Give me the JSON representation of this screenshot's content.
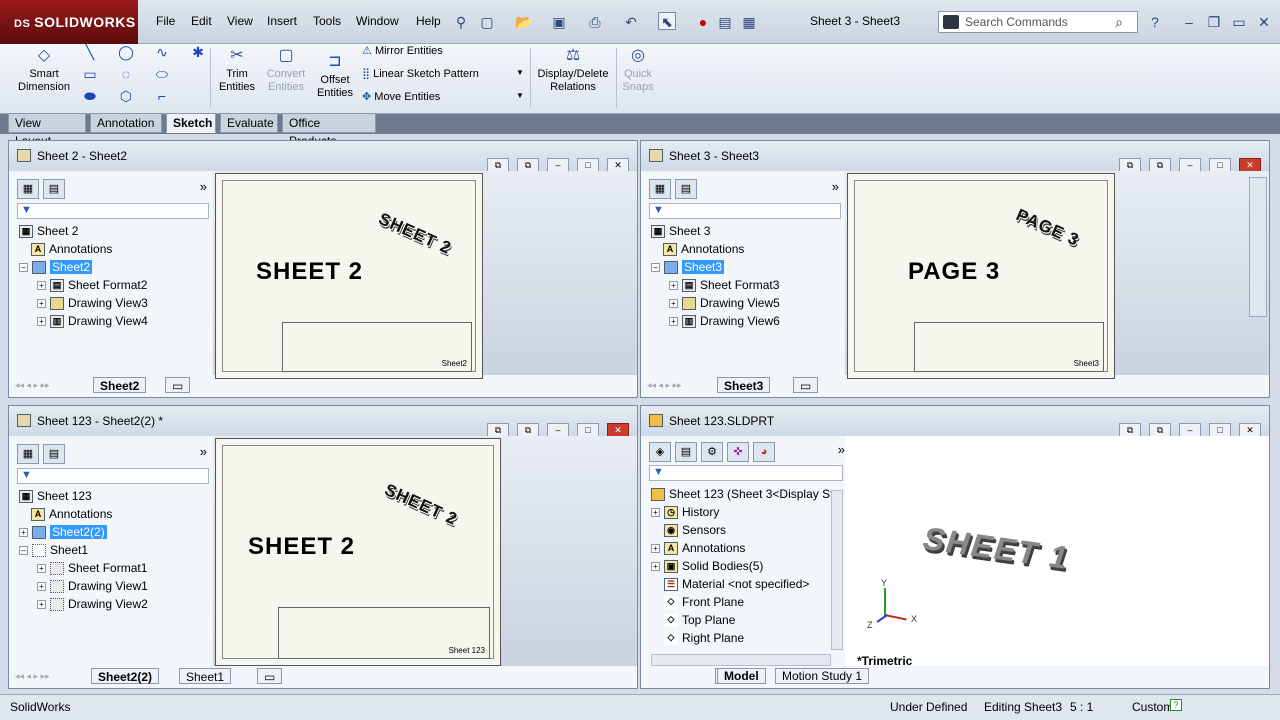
{
  "app": {
    "brand": "SOLIDWORKS",
    "brand_mark": "DS",
    "doc_title": "Sheet 3 - Sheet3"
  },
  "menu": [
    "File",
    "Edit",
    "View",
    "Insert",
    "Tools",
    "Window",
    "Help"
  ],
  "search": {
    "placeholder": "Search Commands"
  },
  "commands": {
    "smart_dimension": "Smart Dimension",
    "trim": "Trim Entities",
    "convert": "Convert Entities",
    "offset": "Offset Entities",
    "mirror": "Mirror Entities",
    "linear_pattern": "Linear Sketch Pattern",
    "move": "Move Entities",
    "display_delete": "Display/Delete Relations",
    "quick_snaps": "Quick Snaps"
  },
  "cm_tabs": [
    "View Layout",
    "Annotation",
    "Sketch",
    "Evaluate",
    "Office Products"
  ],
  "cm_tab_active": 2,
  "pane1": {
    "title": "Sheet 2 - Sheet2",
    "root": "Sheet 2",
    "items": [
      "Annotations",
      "Sheet2",
      "Sheet Format2",
      "Drawing View3",
      "Drawing View4"
    ],
    "sheet_tabs": [
      "Sheet2"
    ],
    "big_text": "SHEET 2",
    "rot_text": "SHEET 2",
    "tb_label": "Sheet2"
  },
  "pane2": {
    "title": "Sheet 3 - Sheet3",
    "root": "Sheet 3",
    "items": [
      "Annotations",
      "Sheet3",
      "Sheet Format3",
      "Drawing View5",
      "Drawing View6"
    ],
    "sheet_tabs": [
      "Sheet3"
    ],
    "big_text": "PAGE 3",
    "rot_text": "PAGE 3",
    "tb_label": "Sheet3"
  },
  "pane3": {
    "title": "Sheet 123 - Sheet2(2) *",
    "root": "Sheet 123",
    "items": [
      "Annotations",
      "Sheet2(2)",
      "Sheet1",
      "Sheet Format1",
      "Drawing View1",
      "Drawing View2"
    ],
    "sheet_tabs": [
      "Sheet2(2)",
      "Sheet1"
    ],
    "big_text": "SHEET 2",
    "rot_text": "SHEET 2",
    "tb_label": "Sheet 123"
  },
  "pane4": {
    "title": "Sheet 123.SLDPRT",
    "root": "Sheet 123  (Sheet 3<Display St",
    "items": [
      "History",
      "Sensors",
      "Annotations",
      "Solid Bodies(5)",
      "Material <not specified>",
      "Front Plane",
      "Top Plane",
      "Right Plane"
    ],
    "model_text": "SHEET 1",
    "view_label": "*Trimetric",
    "axes": {
      "x": "X",
      "y": "Y",
      "z": "Z"
    },
    "bottom_tabs": [
      "Model",
      "Motion Study 1"
    ]
  },
  "status": {
    "app": "SolidWorks",
    "state": "Under Defined",
    "editing": "Editing Sheet3",
    "scale": "5 : 1",
    "custom": "Custom"
  },
  "colors": {
    "brand": "#9b1b1b",
    "selection": "#3399ff",
    "close": "#c93c2e"
  }
}
